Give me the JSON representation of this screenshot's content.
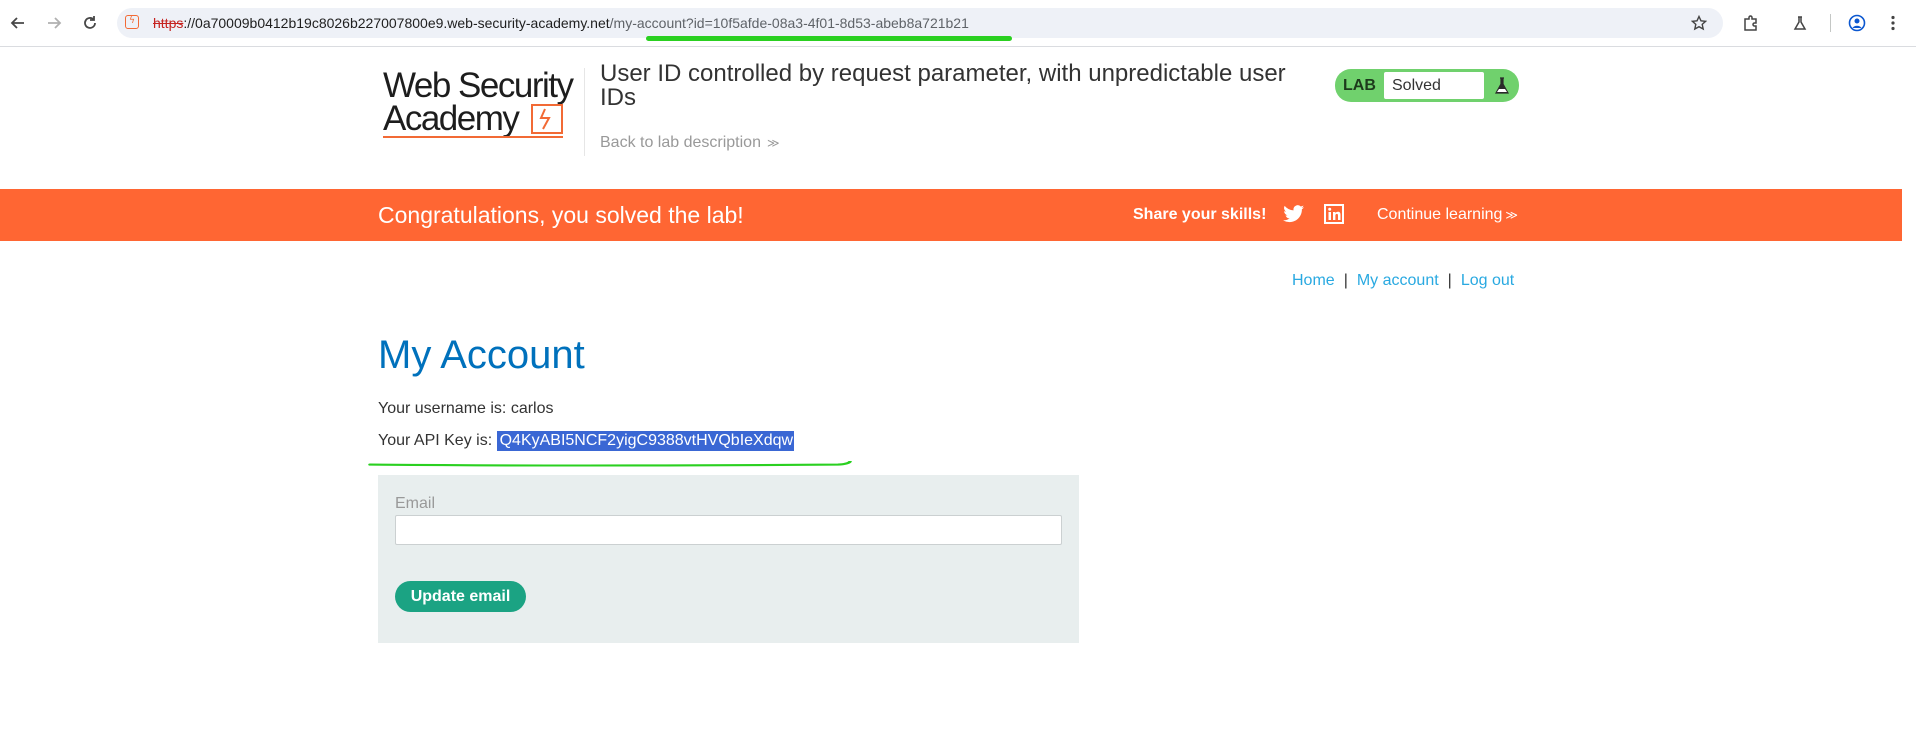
{
  "browser": {
    "url_scheme": "https",
    "url_host": "://0a70009b0412b19c8026b227007800e9.web-security-academy.net",
    "url_path": "/my-account?id=10f5afde-08a3-4f01-8d53-abeb8a721b21",
    "icons": [
      "back-arrow-icon",
      "forward-arrow-icon",
      "reload-icon",
      "site-favicon",
      "bookmark-star-icon",
      "extensions-puzzle-icon",
      "labs-flask-icon",
      "profile-icon",
      "more-menu-icon"
    ],
    "annotation_color": "#2ad020"
  },
  "header": {
    "logo_line1": "Web Security",
    "logo_line2": "Academy",
    "lab_title": "User ID controlled by request parameter, with unpredictable user IDs",
    "back_link": "Back to lab description",
    "back_chevron": "≫",
    "lab_label": "LAB",
    "lab_status": "Solved"
  },
  "banner": {
    "message": "Congratulations, you solved the lab!",
    "share": "Share your skills!",
    "continue": "Continue learning",
    "continue_chevron": "≫",
    "color": "#ff6633"
  },
  "nav": {
    "home": "Home",
    "my_account": "My account",
    "log_out": "Log out",
    "separator": "|"
  },
  "account": {
    "title": "My Account",
    "username_prefix": "Your username is: ",
    "username": "carlos",
    "api_prefix": "Your API Key is: ",
    "api_key": "Q4KyABI5NCF2yigC9388vtHVQbIeXdqw",
    "email_label": "Email",
    "email_value": "",
    "update_button": "Update email"
  },
  "colors": {
    "title_blue": "#0071bc",
    "link_blue": "#29a9e1",
    "button_green": "#1ba383",
    "badge_green": "#70d16d",
    "selection_blue": "#3a67d4"
  }
}
